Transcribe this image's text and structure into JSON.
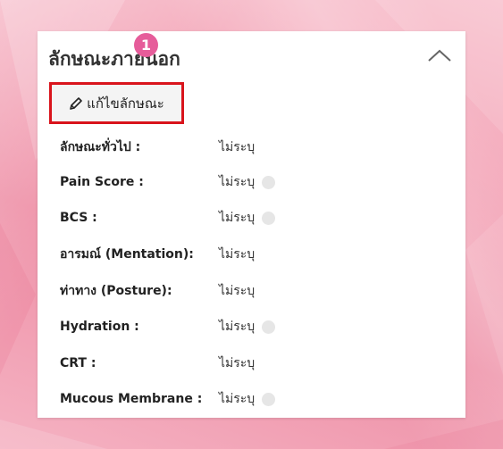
{
  "card": {
    "title": "ลักษณะภายนอก",
    "badge": "1",
    "edit_button_label": "แก้ไขลักษณะ"
  },
  "fields": [
    {
      "label": "ลักษณะทั่วไป :",
      "value": "ไม่ระบุ",
      "indicator": false
    },
    {
      "label": "Pain Score :",
      "value": "ไม่ระบุ",
      "indicator": true
    },
    {
      "label": "BCS :",
      "value": "ไม่ระบุ",
      "indicator": true
    },
    {
      "label": "อารมณ์ (Mentation):",
      "value": "ไม่ระบุ",
      "indicator": false
    },
    {
      "label": "ท่าทาง (Posture):",
      "value": "ไม่ระบุ",
      "indicator": false
    },
    {
      "label": "Hydration :",
      "value": "ไม่ระบุ",
      "indicator": true
    },
    {
      "label": "CRT :",
      "value": "ไม่ระบุ",
      "indicator": false
    },
    {
      "label": "Mucous Membrane :",
      "value": "ไม่ระบุ",
      "indicator": true
    }
  ],
  "icons": {
    "collapse": "chevron-up-icon",
    "edit": "pencil-icon"
  },
  "colors": {
    "highlight_border": "#d9141c",
    "badge": "#e65c9a"
  }
}
